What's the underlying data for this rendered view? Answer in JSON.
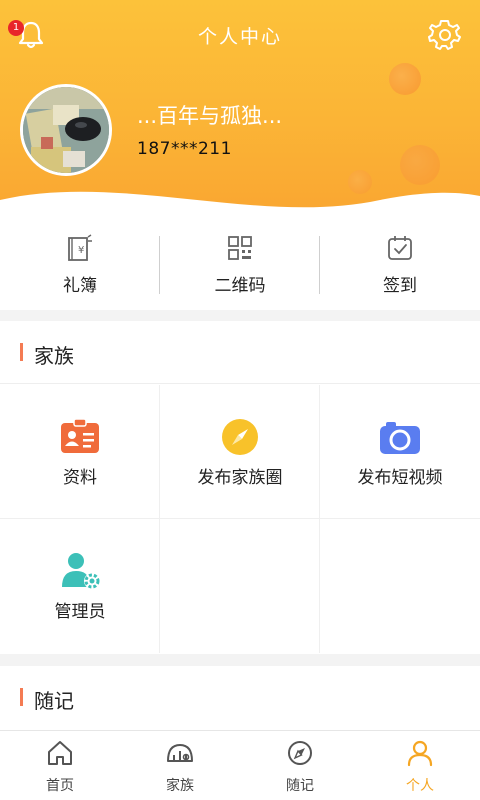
{
  "header": {
    "title": "个人中心",
    "notification_count": "1",
    "bell_icon": "bell-icon",
    "settings_icon": "gear-icon"
  },
  "profile": {
    "username": "...百年与孤独...",
    "phone": "187***211"
  },
  "quick_actions": [
    {
      "label": "礼簿",
      "icon": "gift-book-icon"
    },
    {
      "label": "二维码",
      "icon": "qr-code-icon"
    },
    {
      "label": "签到",
      "icon": "checkin-calendar-icon"
    }
  ],
  "family_section": {
    "title": "家族",
    "items": [
      {
        "label": "资料",
        "icon": "profile-card-icon"
      },
      {
        "label": "发布家族圈",
        "icon": "compass-icon"
      },
      {
        "label": "发布短视频",
        "icon": "camera-icon"
      },
      {
        "label": "管理员",
        "icon": "admin-user-icon"
      }
    ]
  },
  "notes_section": {
    "title": "随记"
  },
  "tabbar": [
    {
      "label": "首页",
      "icon": "home-icon"
    },
    {
      "label": "家族",
      "icon": "family-icon"
    },
    {
      "label": "随记",
      "icon": "notes-compass-icon"
    },
    {
      "label": "个人",
      "icon": "person-icon",
      "active": true
    }
  ],
  "colors": {
    "header_gradient_top": "#fcc23a",
    "header_gradient_bottom": "#f9a531",
    "accent": "#f5a623",
    "section_bar": "#f47b53"
  }
}
